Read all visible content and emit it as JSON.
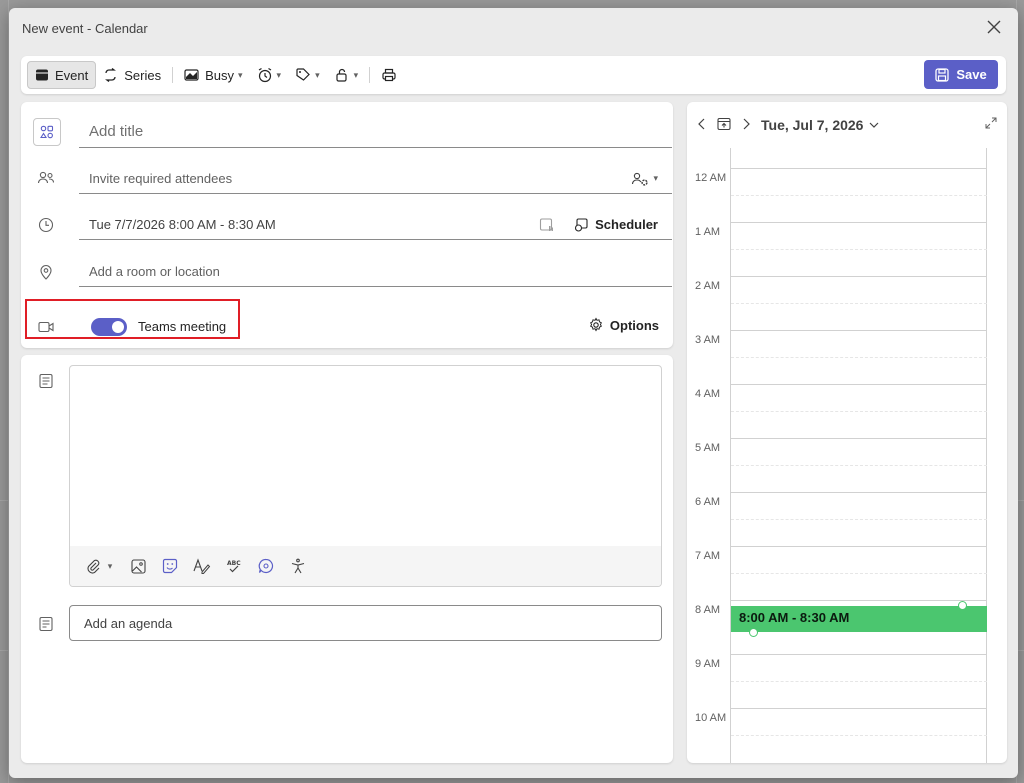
{
  "window": {
    "title": "New event - Calendar"
  },
  "toolbar": {
    "event_label": "Event",
    "series_label": "Series",
    "busy_label": "Busy",
    "save_label": "Save"
  },
  "form": {
    "title_placeholder": "Add title",
    "attendees_placeholder": "Invite required attendees",
    "datetime_value": "Tue 7/7/2026 8:00 AM - 8:30 AM",
    "scheduler_label": "Scheduler",
    "location_placeholder": "Add a room or location",
    "teams_label": "Teams meeting",
    "teams_enabled": true,
    "options_label": "Options",
    "agenda_placeholder": "Add an agenda"
  },
  "calendar": {
    "date_label": "Tue, Jul 7, 2026",
    "hours": [
      "12 AM",
      "1 AM",
      "2 AM",
      "3 AM",
      "4 AM",
      "5 AM",
      "6 AM",
      "7 AM",
      "8 AM",
      "9 AM",
      "10 AM"
    ],
    "event_label": "8:00 AM - 8:30 AM"
  },
  "colors": {
    "accent": "#5b5fc7",
    "event": "#4bc66f",
    "highlight": "#e01e26"
  }
}
